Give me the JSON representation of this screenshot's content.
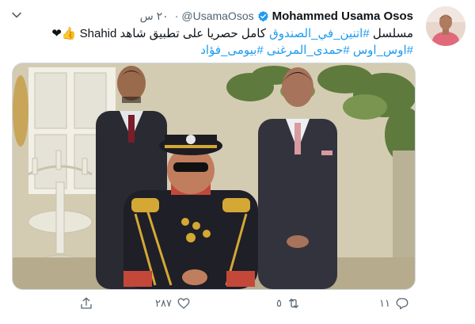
{
  "user": {
    "name": "Mohammed Usama Osos",
    "handle": "@UsamaOsos",
    "time": "٢٠ س"
  },
  "tweet": {
    "line1_pre": "مسلسل ",
    "line1_tag": "#اتنين_في_الصندوق",
    "line1_post": " كامل حصريا على تطبيق شاهد Shahid ",
    "line1_emoji": "👍❤",
    "line2_tags": [
      "#اوس_اوس",
      "#حمدى_المرغنى",
      "#بيومى_فؤاد"
    ]
  },
  "actions": {
    "reply_count": "١١",
    "retweet_count": "٥",
    "like_count": "٢٨٧"
  },
  "colors": {
    "link": "#1d9bf0",
    "muted": "#536471",
    "verified": "#1d9bf0",
    "like_heart": "#e0245e"
  }
}
